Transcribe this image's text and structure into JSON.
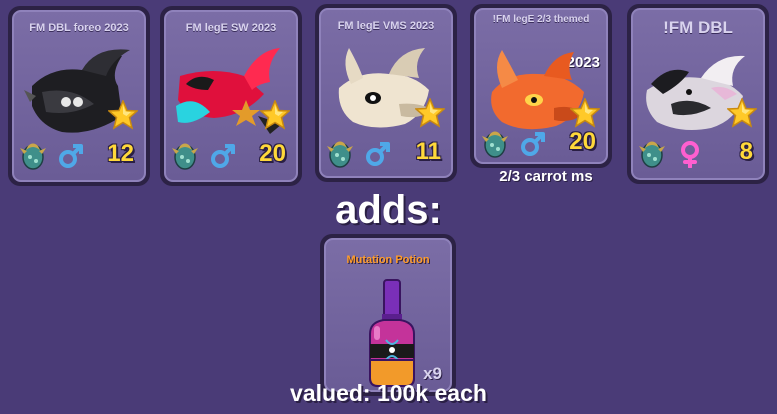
{
  "trade": {
    "pets": [
      {
        "title": "FM DBL foreo 2023",
        "year_tag": "",
        "age": "12",
        "gender": "male",
        "icon": "black-dragon-icon",
        "caption": ""
      },
      {
        "title": "FM legE SW 2023",
        "year_tag": "",
        "age": "20",
        "gender": "male",
        "icon": "red-dragon-icon",
        "caption": ""
      },
      {
        "title": "FM legE VMS 2023",
        "year_tag": "",
        "age": "11",
        "gender": "male",
        "icon": "cream-dragon-icon",
        "caption": ""
      },
      {
        "title": "!FM legE 2/3 themed",
        "year_tag": "2023",
        "age": "20",
        "gender": "male",
        "icon": "orange-dragon-icon",
        "caption": "2/3 carrot ms"
      },
      {
        "title": "!FM DBL",
        "year_tag": "",
        "age": "8",
        "gender": "female",
        "icon": "white-black-dragon-icon",
        "caption": ""
      }
    ],
    "adds_label": "adds:",
    "potion": {
      "title": "Mutation Potion",
      "quantity": "x9",
      "icon": "mutation-potion-icon"
    },
    "value_note": "valued: 100k each"
  },
  "colors": {
    "background": "#4a3b77",
    "card": "#6a5c96",
    "age": "#ffd83a",
    "male": "#4fa8e8",
    "female": "#ff5fd0",
    "potion_title": "#ff9d2a"
  }
}
